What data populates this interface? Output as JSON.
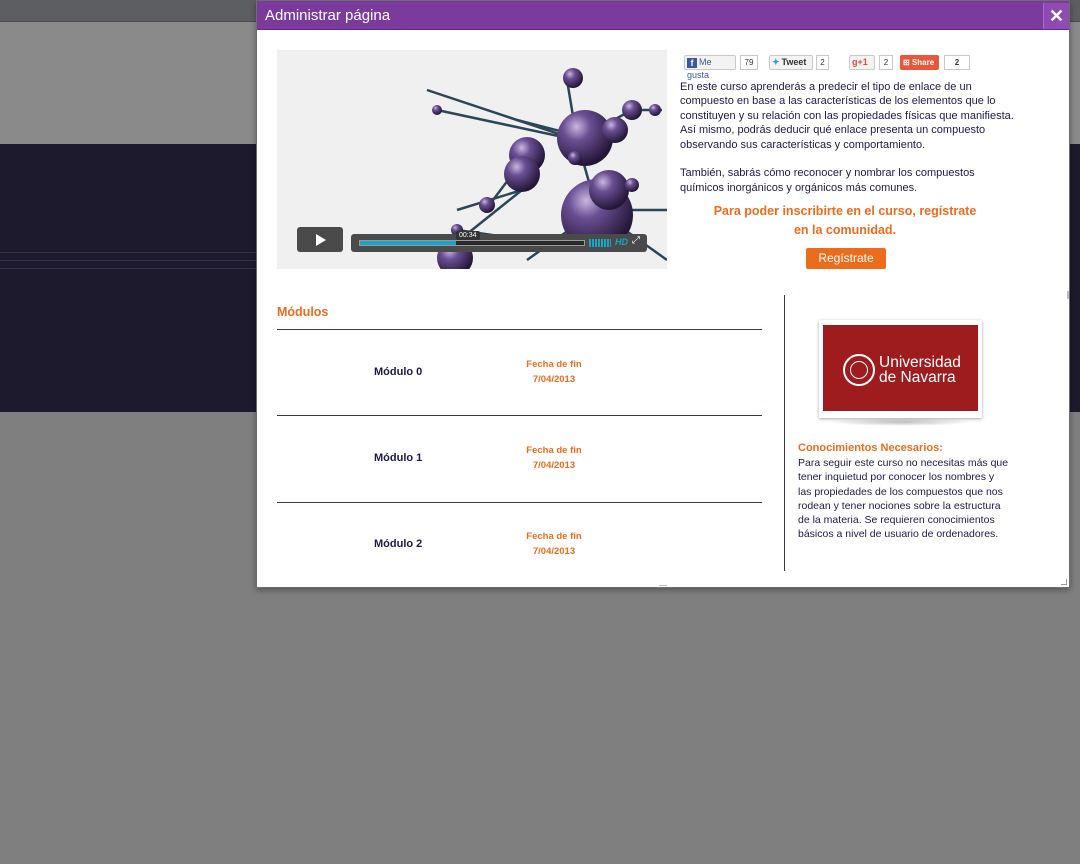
{
  "dialog": {
    "title": "Administrar página",
    "close_label": "✕"
  },
  "video": {
    "time": "00:34",
    "progress": 0.43,
    "hd_label": "HD"
  },
  "social": {
    "facebook_label": "Me gusta",
    "facebook_count": "79",
    "twitter_label": "Tweet",
    "twitter_count": "2",
    "gplus_label": "+1",
    "gplus_count": "2",
    "share_label": "Share",
    "share_count": "2"
  },
  "description": {
    "p1": "En este curso aprenderás a predecir el tipo de enlace de un compuesto en base a las características de los elementos que lo constituyen y su relación con las propiedades físicas que manifiesta. Así mismo, podrás deducir qué enlace presenta un compuesto observando sus características y comportamiento.",
    "p2": "También, sabrás cómo reconocer y nombrar los compuestos químicos inorgánicos y orgánicos más comunes."
  },
  "cta": {
    "line1": "Para poder inscribirte en el curso, regístrate",
    "line2": "en la comunidad.",
    "button": "Regístrate"
  },
  "modules": {
    "title": "Módulos",
    "items": [
      {
        "name": "Módulo 0",
        "date_label": "Fecha de fin",
        "date": "7/04/2013"
      },
      {
        "name": "Módulo 1",
        "date_label": "Fecha de fin",
        "date": "7/04/2013"
      },
      {
        "name": "Módulo 2",
        "date_label": "Fecha de fin",
        "date": "7/04/2013"
      }
    ]
  },
  "university": {
    "name_line1": "Universidad",
    "name_line2": "de Navarra",
    "brand_color": "#9e1b1e"
  },
  "requirements": {
    "title": "Conocimientos Necesarios:",
    "text": "Para seguir este curso no necesitas más que tener inquietud por conocer los nombres y las propiedades de los compuestos que nos rodean y tener nociones sobre la estructura de la materia. Se requieren conocimientos básicos a nivel de usuario de ordenadores."
  },
  "colors": {
    "title_bar": "#7b3b9c",
    "accent": "#ec6c1c",
    "text": "#1d1b44",
    "video_progress": "#16a5c6"
  }
}
